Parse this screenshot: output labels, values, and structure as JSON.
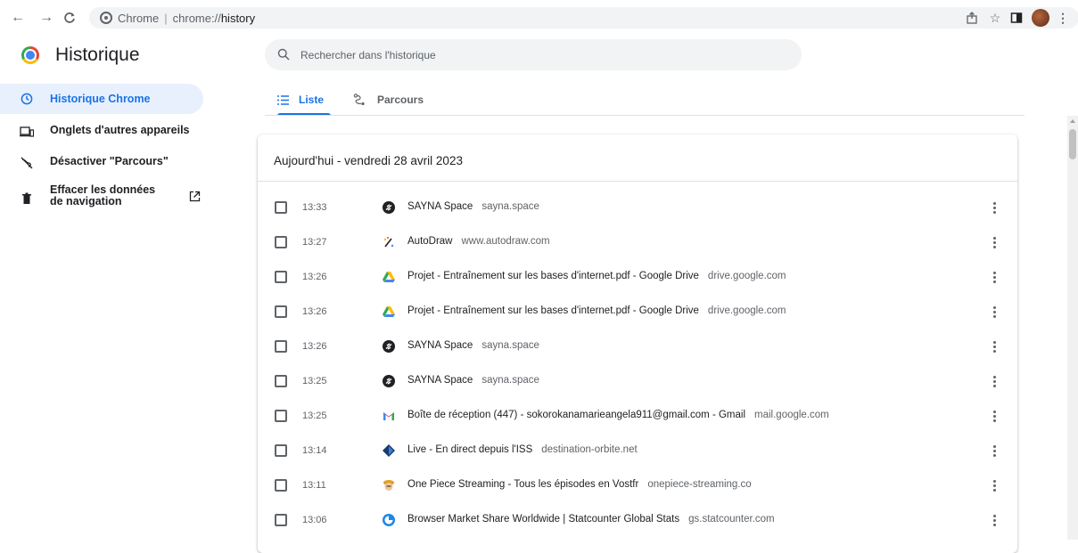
{
  "browser": {
    "site_chip": "Chrome",
    "url_scheme": "chrome://",
    "url_path": "history"
  },
  "app": {
    "title": "Historique"
  },
  "sidebar": {
    "items": [
      {
        "label": "Historique Chrome",
        "icon": "clock-icon",
        "active": true
      },
      {
        "label": "Onglets d'autres appareils",
        "icon": "devices-icon",
        "active": false
      },
      {
        "label": "Désactiver \"Parcours\"",
        "icon": "journeys-off-icon",
        "active": false
      },
      {
        "label": "Effacer les données de navigation",
        "icon": "trash-icon",
        "active": false
      }
    ]
  },
  "search": {
    "placeholder": "Rechercher dans l'historique"
  },
  "tabs": [
    {
      "label": "Liste",
      "active": true
    },
    {
      "label": "Parcours",
      "active": false
    }
  ],
  "day_header": "Aujourd'hui - vendredi 28 avril 2023",
  "entries": [
    {
      "time": "13:33",
      "title": "SAYNA Space",
      "domain": "sayna.space",
      "favicon": "sayna-icon"
    },
    {
      "time": "13:27",
      "title": "AutoDraw",
      "domain": "www.autodraw.com",
      "favicon": "autodraw-icon"
    },
    {
      "time": "13:26",
      "title": "Projet - Entraînement sur les bases d'internet.pdf - Google Drive",
      "domain": "drive.google.com",
      "favicon": "google-drive-icon"
    },
    {
      "time": "13:26",
      "title": "Projet - Entraînement sur les bases d'internet.pdf - Google Drive",
      "domain": "drive.google.com",
      "favicon": "google-drive-icon"
    },
    {
      "time": "13:26",
      "title": "SAYNA Space",
      "domain": "sayna.space",
      "favicon": "sayna-icon"
    },
    {
      "time": "13:25",
      "title": "SAYNA Space",
      "domain": "sayna.space",
      "favicon": "sayna-icon"
    },
    {
      "time": "13:25",
      "title": "Boîte de réception (447) - sokorokanamarieangela911@gmail.com - Gmail",
      "domain": "mail.google.com",
      "favicon": "gmail-icon"
    },
    {
      "time": "13:14",
      "title": "Live - En direct depuis l'ISS",
      "domain": "destination-orbite.net",
      "favicon": "orbite-icon"
    },
    {
      "time": "13:11",
      "title": "One Piece Streaming - Tous les épisodes en Vostfr",
      "domain": "onepiece-streaming.co",
      "favicon": "onepiece-icon"
    },
    {
      "time": "13:06",
      "title": "Browser Market Share Worldwide | Statcounter Global Stats",
      "domain": "gs.statcounter.com",
      "favicon": "statcounter-icon"
    }
  ],
  "colors": {
    "accent": "#1a73e8",
    "active_bg": "#e8f0fe",
    "text_secondary": "#5f6368"
  }
}
